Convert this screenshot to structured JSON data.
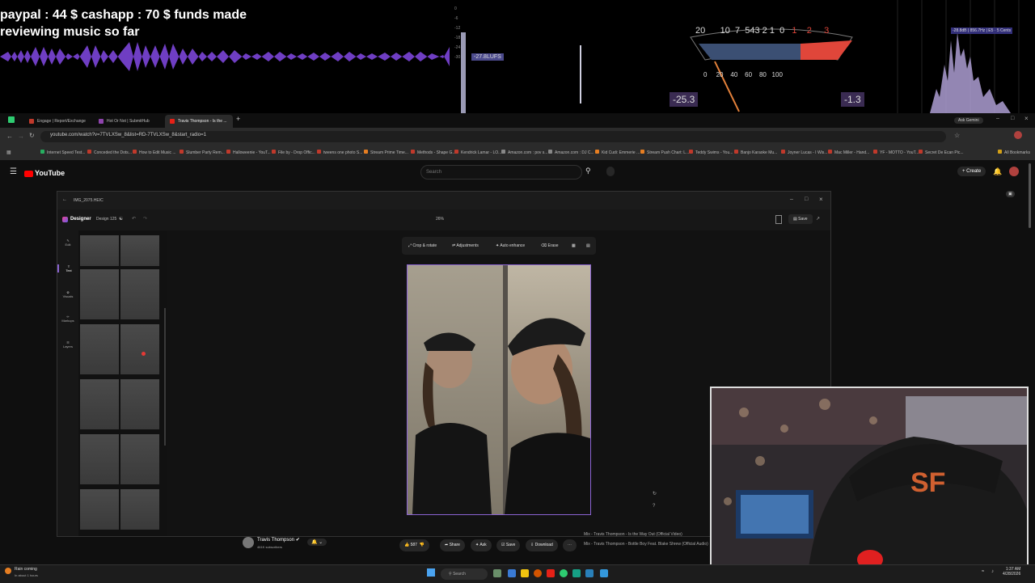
{
  "overlay": {
    "funds_line1": "paypal : 44 $  cashapp : 70 $ funds made",
    "funds_line2": "reviewing music so far",
    "meter_tag": "-27.8LUFS",
    "vu_top_left": [
      "20",
      "10",
      "7",
      "5",
      "4",
      "3",
      "2",
      "1",
      "0"
    ],
    "vu_top_red": [
      "1",
      "2",
      "3"
    ],
    "vu_bottom": [
      "0",
      "20",
      "40",
      "60",
      "80",
      "100"
    ],
    "db_left": "-25.3",
    "db_right": "-1.3",
    "spectrum_tag": "-28.8dB | 856.7Hz | E5 · 5 Cents"
  },
  "browser": {
    "tabs": [
      {
        "label": "Engage | Report/Exchange",
        "color": "#c0392b"
      },
      {
        "label": "Hot Or Not | SubmitHub",
        "color": "#8e44ad"
      },
      {
        "label": "Travis Thompson - Is the ...",
        "color": "#e62117",
        "active": true
      }
    ],
    "new_tab": "+",
    "gemini": "Ask Gemini",
    "url": "youtube.com/watch?v=7TVLXSw_8&list=RD-7TVLXSw_8&start_radio=1",
    "bookmarks": [
      "Internet Speed Test...",
      "Conceded the Dots...",
      "How to Edit Music ...",
      "Slumber Party Rem...",
      "Halloweenie - YouT...",
      "File by - Drop Offic...",
      "tweens one photo S...",
      "Stream Prime Time...",
      "Methods - Shape G...",
      "Kendrick Lamar - LO...",
      "Amazon.com : pov s...",
      "Amazon.com : DJ C...",
      "Kid Cudi: Emmerie ...",
      "Stream Push Chart: L...",
      "Teddy Swims - You...",
      "Banjo Karaoke Mu...",
      "Joyner Lucas - I Wis...",
      "Mac Miller - Hand...",
      "YF - MOTTO - YouT...",
      "Secret De Ecan Pic..."
    ],
    "all_bookmarks": "All Bookmarks"
  },
  "youtube": {
    "logo": "YouTube",
    "search_placeholder": "Search",
    "create": "Create"
  },
  "designer": {
    "file_title": "IMG_2075.HEIC",
    "app": "Designer",
    "doc": "Design 125",
    "zoom": "26%",
    "save": "Save",
    "rail": [
      "Edit",
      "Text",
      "Visuals",
      "Markups",
      "Layers"
    ],
    "tools": [
      "Crop & rotate",
      "Adjustments",
      "Auto enhance",
      "Erase"
    ]
  },
  "below": {
    "channel_name": "Travis Thompson",
    "subscribers": "461K subscribers",
    "likes": "587",
    "share": "Share",
    "ask": "Ask",
    "save": "Save",
    "download": "Download",
    "side_line1": "Mix - Travis Thompson - Is the Way Out (Official Video)",
    "side_line2": "Mix - Travis Thompson - Bottle Boy Feat. Blake Shrew (Official Audio)"
  },
  "taskbar": {
    "weather_title": "Rain coming",
    "weather_sub": "In about 1 hours",
    "search": "Search",
    "time": "1:37 AM",
    "date": "4/28/2026"
  },
  "colors": {
    "wave": "#7b45d8",
    "accent_red": "#e0463a",
    "designer_accent": "#8a63d2"
  }
}
